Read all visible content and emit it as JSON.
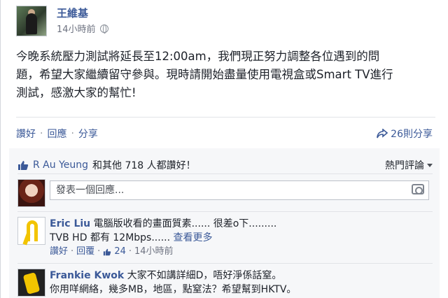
{
  "post": {
    "author": "王維基",
    "timestamp": "14小時前",
    "text_lines": [
      "今晚系統壓力測試將延長至12:00am，我們現正努力調整各位遇到的問",
      "題，希望大家繼續留守參與。現時請開始盡量使用電視盒或Smart TV進行",
      "測試，感激大家的幫忙!"
    ]
  },
  "actions": {
    "like": "讚好",
    "comment": "回應",
    "share": "分享",
    "dot": "·",
    "shares_count": "26則分享"
  },
  "likes": {
    "name": "R Au Yeung",
    "rest": "和其他 718 人都讚好！",
    "sort_label": "熱門評論"
  },
  "composer": {
    "placeholder": "發表一個回應..."
  },
  "comments": [
    {
      "name": "Eric Liu",
      "line1": "電腦版收看的畫面質素...... 很差o下.........",
      "line2": "TVB HD 都有 12Mbps......",
      "see_more": "查看更多",
      "reply": "回覆",
      "like_count": "24",
      "time": "14小時前",
      "like": "讚好"
    },
    {
      "name": "Frankie Kwok",
      "line1": "大家不如講詳細D，唔好淨係話窒。",
      "line2": "你用咩網絡，幾多MB，地區，點窒法？希望幫到HKTV。"
    }
  ]
}
